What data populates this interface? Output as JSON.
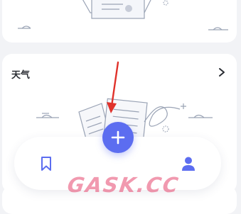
{
  "weather_card": {
    "title": "天气"
  },
  "bottom_nav": {
    "items": [
      {
        "icon": "bookmark-icon"
      },
      {
        "icon": "add-icon"
      },
      {
        "icon": "person-icon"
      }
    ]
  },
  "watermark": {
    "text": "GASK.CC"
  },
  "colors": {
    "accent": "#5c6df0",
    "background": "#f2f3f6",
    "card": "#ffffff",
    "annotation_arrow": "#e0322b"
  }
}
